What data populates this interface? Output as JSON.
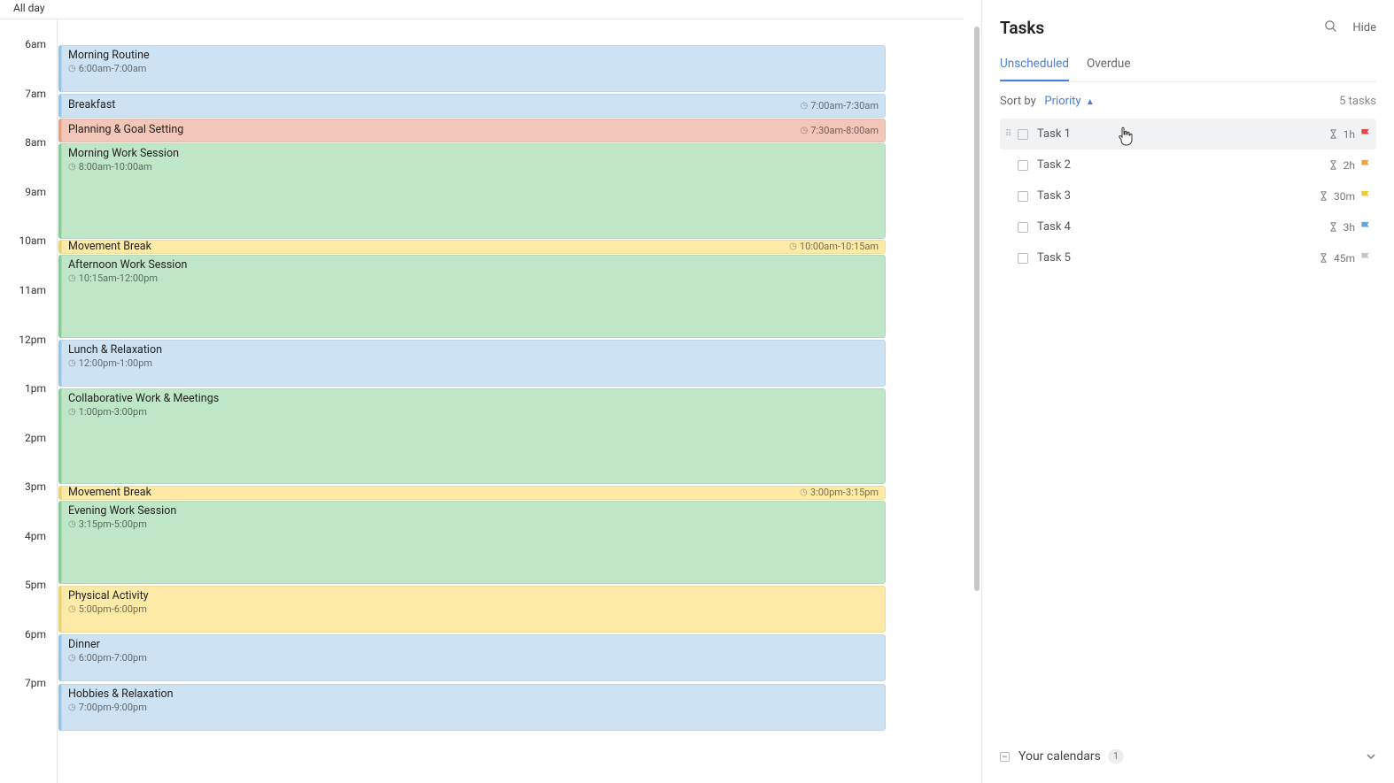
{
  "allday_label": "All day",
  "hours": [
    "6am",
    "7am",
    "8am",
    "9am",
    "10am",
    "11am",
    "12pm",
    "1pm",
    "2pm",
    "3pm",
    "4pm",
    "5pm",
    "6pm",
    "7pm"
  ],
  "events": {
    "e0": {
      "title": "Morning Routine",
      "time": "6:00am-7:00am"
    },
    "e1": {
      "title": "Breakfast",
      "time": "7:00am-7:30am"
    },
    "e2": {
      "title": "Planning & Goal Setting",
      "time": "7:30am-8:00am"
    },
    "e3": {
      "title": "Morning Work Session",
      "time": "8:00am-10:00am"
    },
    "e4": {
      "title": "Movement Break",
      "time": "10:00am-10:15am"
    },
    "e5": {
      "title": "Afternoon Work Session",
      "time": "10:15am-12:00pm"
    },
    "e6": {
      "title": "Lunch & Relaxation",
      "time": "12:00pm-1:00pm"
    },
    "e7": {
      "title": "Collaborative Work & Meetings",
      "time": "1:00pm-3:00pm"
    },
    "e8": {
      "title": "Movement Break",
      "time": "3:00pm-3:15pm"
    },
    "e9": {
      "title": "Evening Work Session",
      "time": "3:15pm-5:00pm"
    },
    "e10": {
      "title": "Physical Activity",
      "time": "5:00pm-6:00pm"
    },
    "e11": {
      "title": "Dinner",
      "time": "6:00pm-7:00pm"
    },
    "e12": {
      "title": "Hobbies & Relaxation",
      "time": "7:00pm-9:00pm"
    }
  },
  "sidebar": {
    "title": "Tasks",
    "hide_label": "Hide",
    "tabs": {
      "unscheduled": "Unscheduled",
      "overdue": "Overdue"
    },
    "sort_label": "Sort by",
    "sort_field": "Priority",
    "task_count": "5 tasks",
    "tasks": {
      "t1": {
        "name": "Task 1",
        "dur": "1h"
      },
      "t2": {
        "name": "Task 2",
        "dur": "2h"
      },
      "t3": {
        "name": "Task 3",
        "dur": "30m"
      },
      "t4": {
        "name": "Task 4",
        "dur": "3h"
      },
      "t5": {
        "name": "Task 5",
        "dur": "45m"
      }
    },
    "calgroup": {
      "label": "Your calendars",
      "count": "1"
    }
  }
}
